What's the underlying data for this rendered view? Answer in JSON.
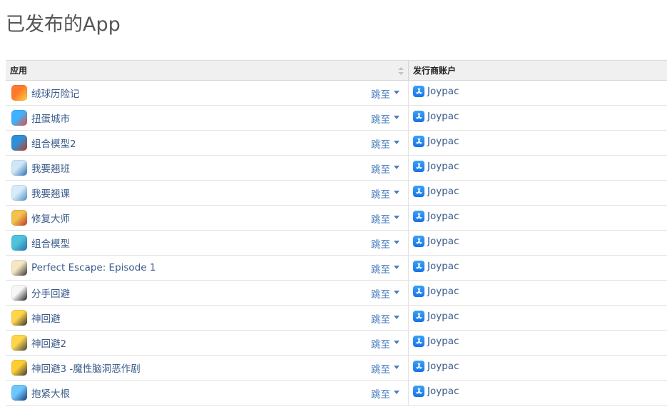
{
  "title": "已发布的App",
  "table": {
    "headers": {
      "app": "应用",
      "publisher": "发行商账户"
    },
    "rows": [
      {
        "name": "绒球历险记",
        "jump": "跳至",
        "publisher": "Joypac",
        "icon": "pompom-game-icon",
        "colors": [
          "#ff7a2a",
          "#ffd23f"
        ]
      },
      {
        "name": "扭蛋城市",
        "jump": "跳至",
        "publisher": "Joypac",
        "icon": "capsule-city-icon",
        "colors": [
          "#3db3ff",
          "#e84d3c"
        ]
      },
      {
        "name": "组合模型2",
        "jump": "跳至",
        "publisher": "Joypac",
        "icon": "model-combo-2-icon",
        "colors": [
          "#2f8fd6",
          "#c23b22"
        ]
      },
      {
        "name": "我要翘班",
        "jump": "跳至",
        "publisher": "Joypac",
        "icon": "skip-work-icon",
        "colors": [
          "#cfe6f7",
          "#2d6fb3"
        ]
      },
      {
        "name": "我要翘课",
        "jump": "跳至",
        "publisher": "Joypac",
        "icon": "skip-class-icon",
        "colors": [
          "#d7ecfa",
          "#4a90c8"
        ]
      },
      {
        "name": "修复大师",
        "jump": "跳至",
        "publisher": "Joypac",
        "icon": "repair-master-icon",
        "colors": [
          "#f2c14e",
          "#c0392b"
        ]
      },
      {
        "name": "组合模型",
        "jump": "跳至",
        "publisher": "Joypac",
        "icon": "model-combo-icon",
        "colors": [
          "#4fc3d9",
          "#2a6fb0"
        ]
      },
      {
        "name": "Perfect Escape: Episode 1",
        "jump": "跳至",
        "publisher": "Joypac",
        "icon": "perfect-escape-icon",
        "colors": [
          "#f5e6c4",
          "#333333"
        ]
      },
      {
        "name": "分手回避",
        "jump": "跳至",
        "publisher": "Joypac",
        "icon": "breakup-dodge-icon",
        "colors": [
          "#f7f7f7",
          "#222222"
        ]
      },
      {
        "name": "神回避",
        "jump": "跳至",
        "publisher": "Joypac",
        "icon": "god-dodge-icon",
        "colors": [
          "#ffd54a",
          "#333333"
        ]
      },
      {
        "name": "神回避2",
        "jump": "跳至",
        "publisher": "Joypac",
        "icon": "god-dodge-2-icon",
        "colors": [
          "#ffd54a",
          "#444444"
        ]
      },
      {
        "name": "神回避3 -魔性脑洞恶作剧",
        "jump": "跳至",
        "publisher": "Joypac",
        "icon": "god-dodge-3-icon",
        "colors": [
          "#ffcc33",
          "#3a3a3a"
        ]
      },
      {
        "name": "抱紧大根",
        "jump": "跳至",
        "publisher": "Joypac",
        "icon": "hold-tight-icon",
        "colors": [
          "#6ec6ff",
          "#1b3f75"
        ]
      }
    ]
  },
  "accent": "#4a7fbf"
}
